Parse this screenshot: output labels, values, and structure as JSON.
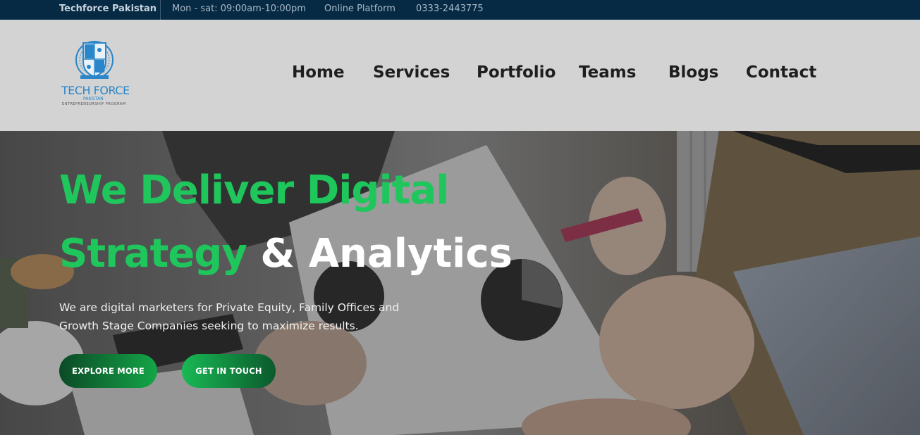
{
  "topbar": {
    "brand": "Techforce Pakistan",
    "hours": "Mon - sat: 09:00am-10:00pm",
    "platform": "Online Platform",
    "phone": "0333-2443775"
  },
  "logo": {
    "text": "TECH FORCE",
    "sub": "PAKISTAN",
    "tagline": "ENTREPRENEURSHIP PROGRAM"
  },
  "nav": {
    "items": [
      {
        "label": "Home"
      },
      {
        "label": "Services"
      },
      {
        "label": "Portfolio"
      },
      {
        "label": "Teams"
      },
      {
        "label": "Blogs"
      },
      {
        "label": "Contact"
      }
    ]
  },
  "hero": {
    "headline_line1": "We Deliver Digital",
    "headline_green": "Strategy",
    "headline_white": "& Analytics",
    "subtext": "We are digital marketers for Private Equity, Family Offices and Growth Stage Companies seeking to maximize results.",
    "explore_label": "EXPLORE MORE",
    "touch_label": "GET IN TOUCH"
  },
  "colors": {
    "topbar_bg": "#062a44",
    "header_bg": "#d3d3d3",
    "accent_green": "#1fc65c",
    "logo_blue": "#2a86c8"
  }
}
